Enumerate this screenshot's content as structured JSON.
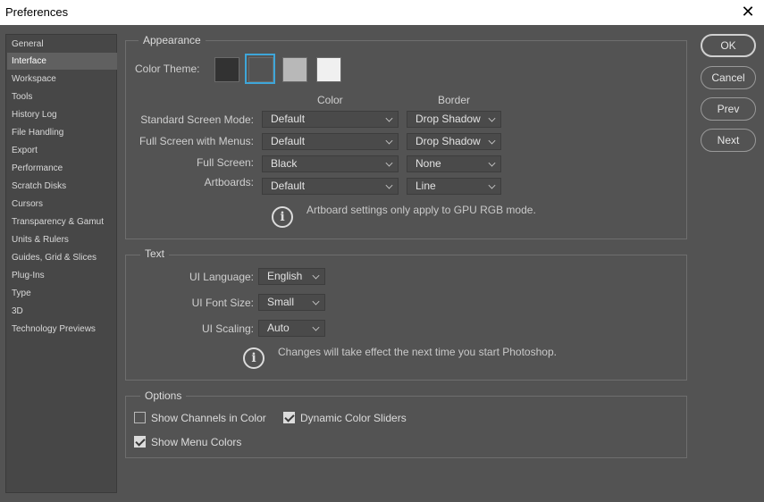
{
  "window": {
    "title": "Preferences",
    "close_glyph": "✕"
  },
  "sidebar": {
    "items": [
      {
        "label": "General"
      },
      {
        "label": "Interface",
        "active": true
      },
      {
        "label": "Workspace"
      },
      {
        "label": "Tools"
      },
      {
        "label": "History Log"
      },
      {
        "label": "File Handling"
      },
      {
        "label": "Export"
      },
      {
        "label": "Performance"
      },
      {
        "label": "Scratch Disks"
      },
      {
        "label": "Cursors"
      },
      {
        "label": "Transparency & Gamut"
      },
      {
        "label": "Units & Rulers"
      },
      {
        "label": "Guides, Grid & Slices"
      },
      {
        "label": "Plug-Ins"
      },
      {
        "label": "Type"
      },
      {
        "label": "3D"
      },
      {
        "label": "Technology Previews"
      }
    ]
  },
  "appearance": {
    "legend": "Appearance",
    "color_theme_label": "Color Theme:",
    "themes": [
      {
        "color": "#323232",
        "selected": false
      },
      {
        "color": "#535353",
        "selected": true
      },
      {
        "color": "#b8b8b8",
        "selected": false
      },
      {
        "color": "#f0f0f0",
        "selected": false
      }
    ],
    "col_color": "Color",
    "col_border": "Border",
    "rows": [
      {
        "label": "Standard Screen Mode:",
        "color": "Default",
        "border": "Drop Shadow"
      },
      {
        "label": "Full Screen with Menus:",
        "color": "Default",
        "border": "Drop Shadow"
      },
      {
        "label": "Full Screen:",
        "color": "Black",
        "border": "None"
      },
      {
        "label": "Artboards:",
        "color": "Default",
        "border": "Line"
      }
    ],
    "note": "Artboard settings only apply to GPU RGB mode.",
    "info_glyph": "i"
  },
  "text": {
    "legend": "Text",
    "ui_language_label": "UI Language:",
    "ui_language": "English",
    "ui_font_size_label": "UI Font Size:",
    "ui_font_size": "Small",
    "ui_scaling_label": "UI Scaling:",
    "ui_scaling": "Auto",
    "note": "Changes will take effect the next time you start Photoshop.",
    "info_glyph": "i"
  },
  "options": {
    "legend": "Options",
    "show_channels_in_color": {
      "label": "Show Channels in Color",
      "checked": false
    },
    "dynamic_color_sliders": {
      "label": "Dynamic Color Sliders",
      "checked": true
    },
    "show_menu_colors": {
      "label": "Show Menu Colors",
      "checked": true
    }
  },
  "buttons": {
    "ok": "OK",
    "cancel": "Cancel",
    "prev": "Prev",
    "next": "Next"
  },
  "colors": {
    "accent": "#3ea6d9",
    "panel": "#535353",
    "sidebar": "#474747",
    "selected_item": "#606060"
  },
  "icons": {
    "close": "close-icon",
    "info": "info-icon",
    "chevron": "chevron-down-icon",
    "check": "checkmark-icon"
  }
}
